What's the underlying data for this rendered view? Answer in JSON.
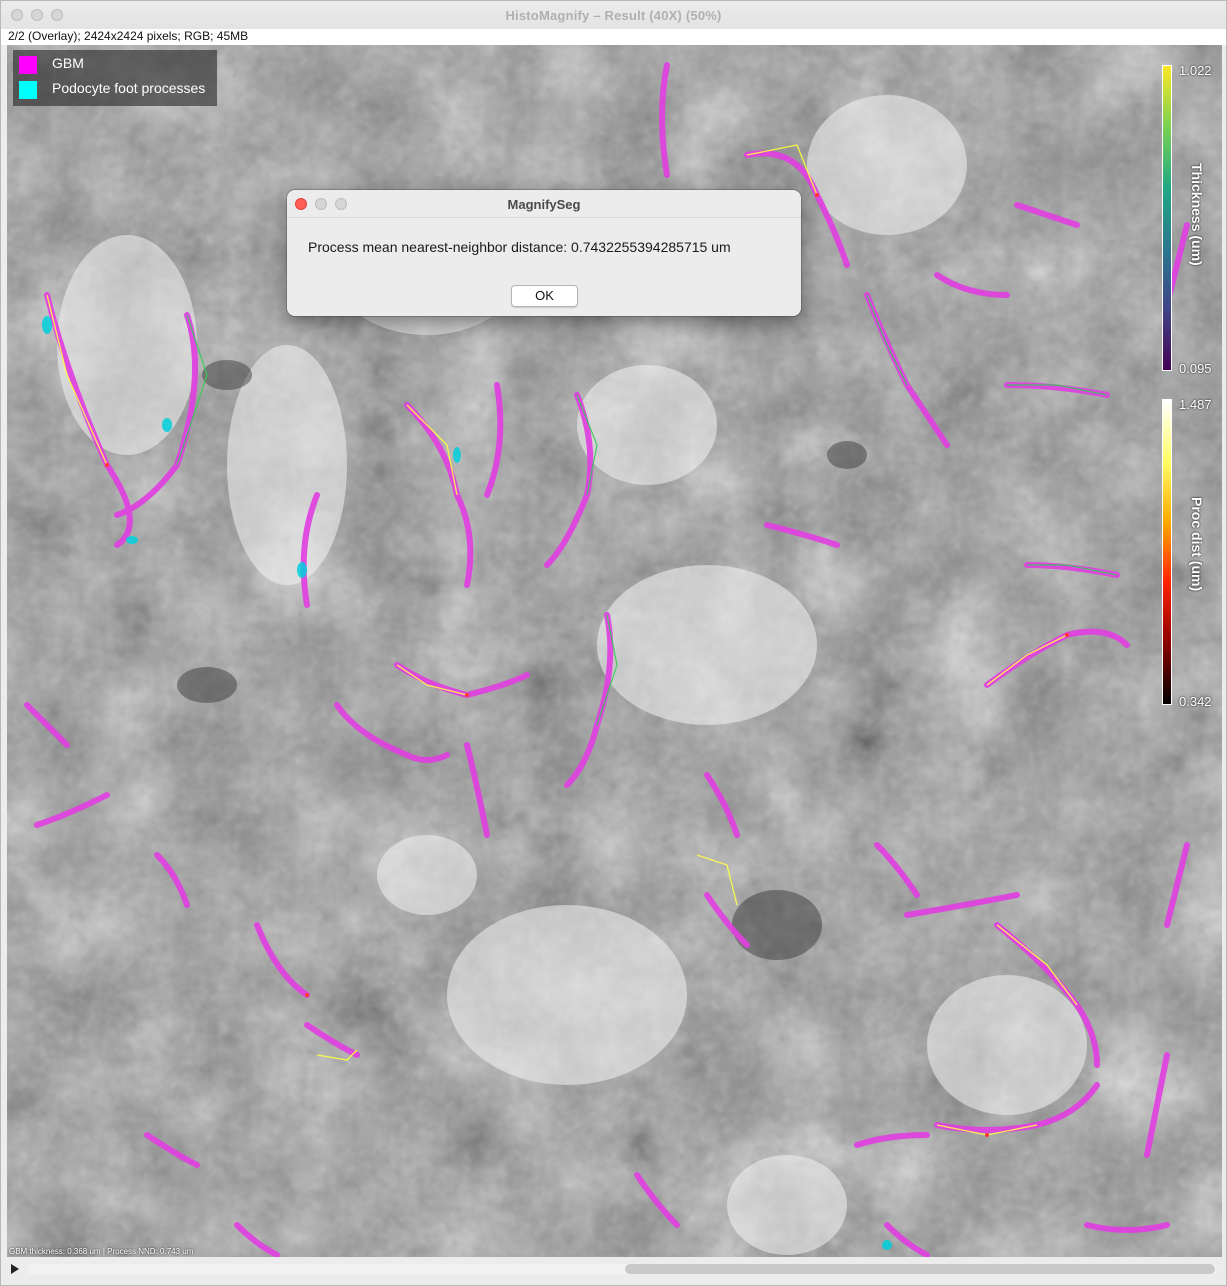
{
  "window": {
    "title": "HistoMagnify – Result (40X) (50%)",
    "info": "2/2 (Overlay); 2424x2424 pixels; RGB; 45MB"
  },
  "legend": {
    "items": [
      {
        "label": "GBM",
        "color": "#ff00ff"
      },
      {
        "label": "Podocyte foot processes",
        "color": "#00ffff"
      }
    ]
  },
  "colorbars": {
    "thickness": {
      "label": "Thickness (um)",
      "max": "1.022",
      "min": "0.095"
    },
    "proc_dist": {
      "label": "Proc dist (um)",
      "max": "1.487",
      "min": "0.342"
    }
  },
  "status": {
    "text": "GBM thickness: 0.368 um   |   Process NND: 0.743 um"
  },
  "dialog": {
    "title": "MagnifySeg",
    "message": "Process mean nearest-neighbor distance: 0.7432255394285715 um",
    "ok_label": "OK"
  },
  "colors": {
    "gbm": "#e040e0",
    "podocyte": "#00e5ee",
    "close_red": "#fe5f57"
  }
}
